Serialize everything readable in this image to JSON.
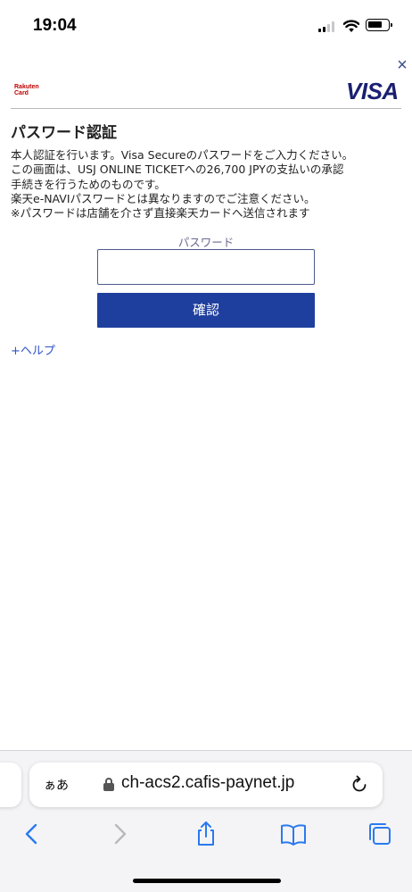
{
  "status_bar": {
    "time": "19:04"
  },
  "header": {
    "close_label": "×",
    "issuer_logo_line1": "Rakuten",
    "issuer_logo_line2": "Card",
    "brand_logo": "VISA"
  },
  "content": {
    "title": "パスワード認証",
    "description_lines": [
      "本人認証を行います。Visa Secureのパスワードをご入力ください。",
      "この画面は、USJ ONLINE TICKETへの26,700 JPYの支払いの承認",
      "手続きを行うためのものです。",
      "楽天e-NAVIパスワードとは異なりますのでご注意ください。",
      "※パスワードは店舗を介さず直接楽天カードへ送信されます"
    ],
    "password_label": "パスワード",
    "password_value": "",
    "confirm_button": "確認",
    "help_link": "+ヘルプ"
  },
  "browser": {
    "aa_label": "ぁあ",
    "url": "ch-acs2.cafis-paynet.jp",
    "icons": [
      "lock-icon",
      "reload-icon",
      "back-icon",
      "forward-icon",
      "share-icon",
      "bookmarks-icon",
      "tabs-icon"
    ]
  },
  "colors": {
    "accent_button": "#1f3f9f",
    "link": "#2f54c8",
    "visa_blue": "#1a1f71",
    "rakuten_red": "#bf0000",
    "safari_blue": "#2a7aef"
  }
}
